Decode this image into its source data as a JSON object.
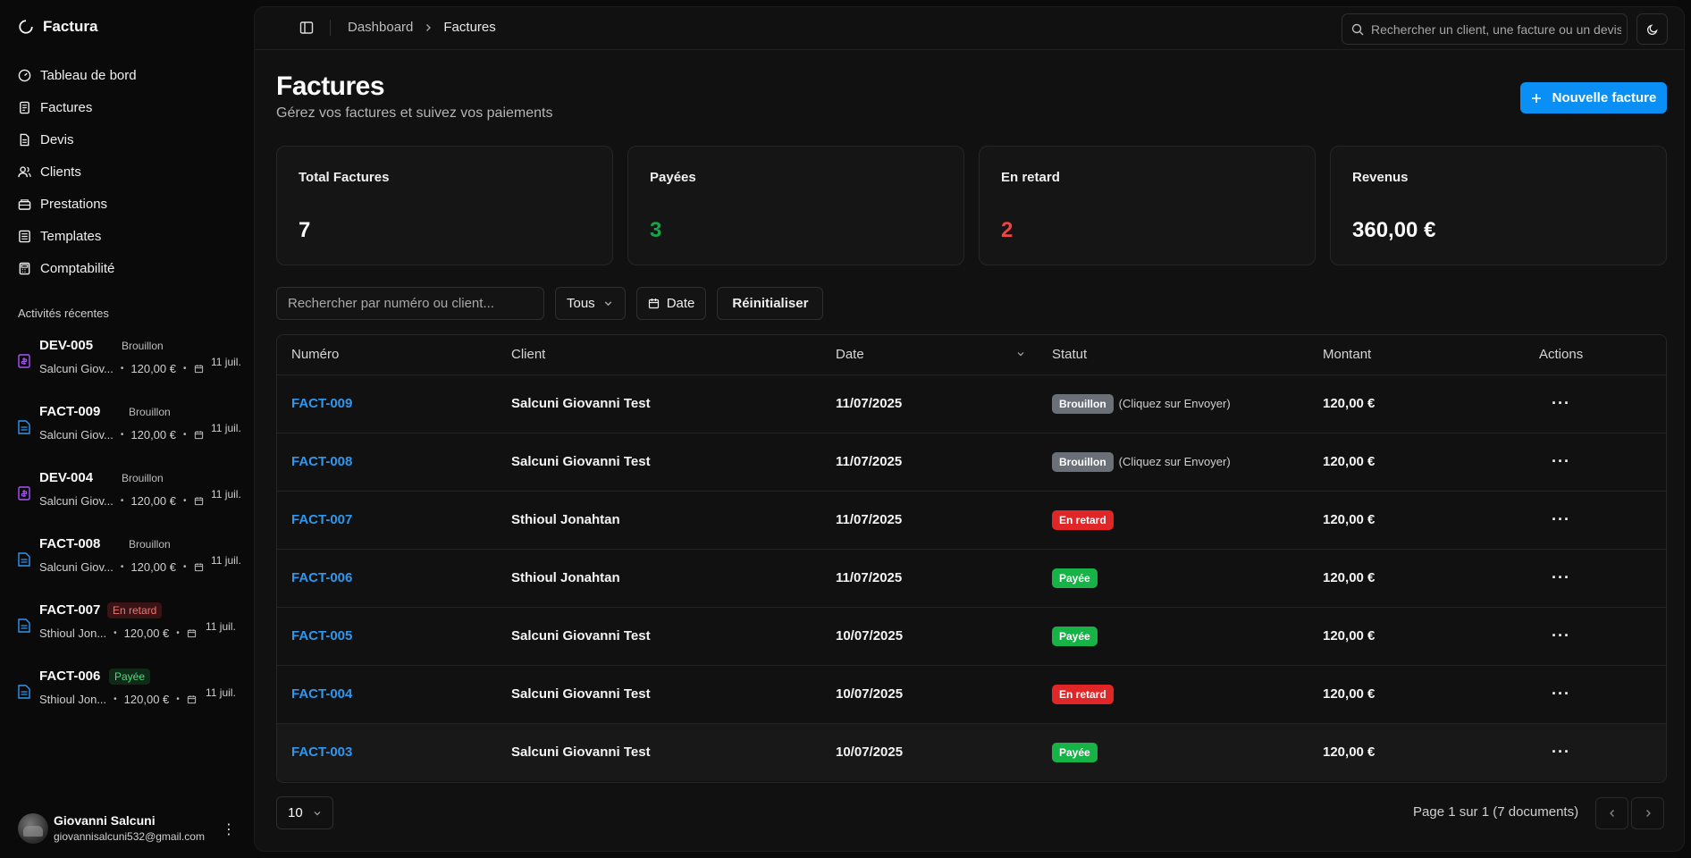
{
  "app": {
    "name": "Factura"
  },
  "sidebar": {
    "nav": [
      {
        "label": "Tableau de bord",
        "icon": "dashboard-icon"
      },
      {
        "label": "Factures",
        "icon": "invoice-icon"
      },
      {
        "label": "Devis",
        "icon": "quote-icon"
      },
      {
        "label": "Clients",
        "icon": "users-icon"
      },
      {
        "label": "Prestations",
        "icon": "box-icon"
      },
      {
        "label": "Templates",
        "icon": "template-icon"
      },
      {
        "label": "Comptabilité",
        "icon": "calculator-icon"
      }
    ],
    "recent_title": "Activités récentes",
    "recent": [
      {
        "title": "DEV-005",
        "status": "Brouillon",
        "kind": "devis",
        "client": "Salcuni Giov...",
        "amount": "120,00 €",
        "date": "11 juil."
      },
      {
        "title": "FACT-009",
        "status": "Brouillon",
        "kind": "facture",
        "client": "Salcuni Giov...",
        "amount": "120,00 €",
        "date": "11 juil."
      },
      {
        "title": "DEV-004",
        "status": "Brouillon",
        "kind": "devis",
        "client": "Salcuni Giov...",
        "amount": "120,00 €",
        "date": "11 juil."
      },
      {
        "title": "FACT-008",
        "status": "Brouillon",
        "kind": "facture",
        "client": "Salcuni Giov...",
        "amount": "120,00 €",
        "date": "11 juil."
      },
      {
        "title": "FACT-007",
        "status": "En retard",
        "kind": "facture",
        "client": "Sthioul Jon...",
        "amount": "120,00 €",
        "date": "11 juil."
      },
      {
        "title": "FACT-006",
        "status": "Payée",
        "kind": "facture",
        "client": "Sthioul Jon...",
        "amount": "120,00 €",
        "date": "11 juil."
      }
    ],
    "user": {
      "name": "Giovanni Salcuni",
      "email": "giovannisalcuni532@gmail.com"
    }
  },
  "topbar": {
    "breadcrumb": [
      "Dashboard",
      "Factures"
    ],
    "search_placeholder": "Rechercher un client, une facture ou un devis..."
  },
  "header": {
    "title": "Factures",
    "subtitle": "Gérez vos factures et suivez vos paiements",
    "new_button": "Nouvelle facture"
  },
  "stats": [
    {
      "label": "Total Factures",
      "value": "7",
      "color": "#fafafa"
    },
    {
      "label": "Payées",
      "value": "3",
      "color": "#16a34a"
    },
    {
      "label": "En retard",
      "value": "2",
      "color": "#ef4444"
    },
    {
      "label": "Revenus",
      "value": "360,00 €",
      "color": "#fafafa"
    }
  ],
  "filters": {
    "search_placeholder": "Rechercher par numéro ou client...",
    "status_select": "Tous",
    "date_button": "Date",
    "reset_button": "Réinitialiser"
  },
  "table": {
    "columns": [
      "Numéro",
      "Client",
      "Date",
      "Statut",
      "Montant",
      "Actions"
    ],
    "rows": [
      {
        "number": "FACT-009",
        "client": "Salcuni Giovanni Test",
        "date": "11/07/2025",
        "status": "Brouillon",
        "status_type": "brouillon",
        "hint": "(Cliquez sur Envoyer)",
        "amount": "120,00 €"
      },
      {
        "number": "FACT-008",
        "client": "Salcuni Giovanni Test",
        "date": "11/07/2025",
        "status": "Brouillon",
        "status_type": "brouillon",
        "hint": "(Cliquez sur Envoyer)",
        "amount": "120,00 €"
      },
      {
        "number": "FACT-007",
        "client": "Sthioul Jonahtan",
        "date": "11/07/2025",
        "status": "En retard",
        "status_type": "retard",
        "hint": "",
        "amount": "120,00 €"
      },
      {
        "number": "FACT-006",
        "client": "Sthioul Jonahtan",
        "date": "11/07/2025",
        "status": "Payée",
        "status_type": "payee",
        "hint": "",
        "amount": "120,00 €"
      },
      {
        "number": "FACT-005",
        "client": "Salcuni Giovanni Test",
        "date": "10/07/2025",
        "status": "Payée",
        "status_type": "payee",
        "hint": "",
        "amount": "120,00 €"
      },
      {
        "number": "FACT-004",
        "client": "Salcuni Giovanni Test",
        "date": "10/07/2025",
        "status": "En retard",
        "status_type": "retard",
        "hint": "",
        "amount": "120,00 €"
      },
      {
        "number": "FACT-003",
        "client": "Salcuni Giovanni Test",
        "date": "10/07/2025",
        "status": "Payée",
        "status_type": "payee",
        "hint": "",
        "amount": "120,00 €"
      }
    ]
  },
  "pagination": {
    "page_size": "10",
    "info": "Page 1 sur 1 (7 documents)"
  }
}
